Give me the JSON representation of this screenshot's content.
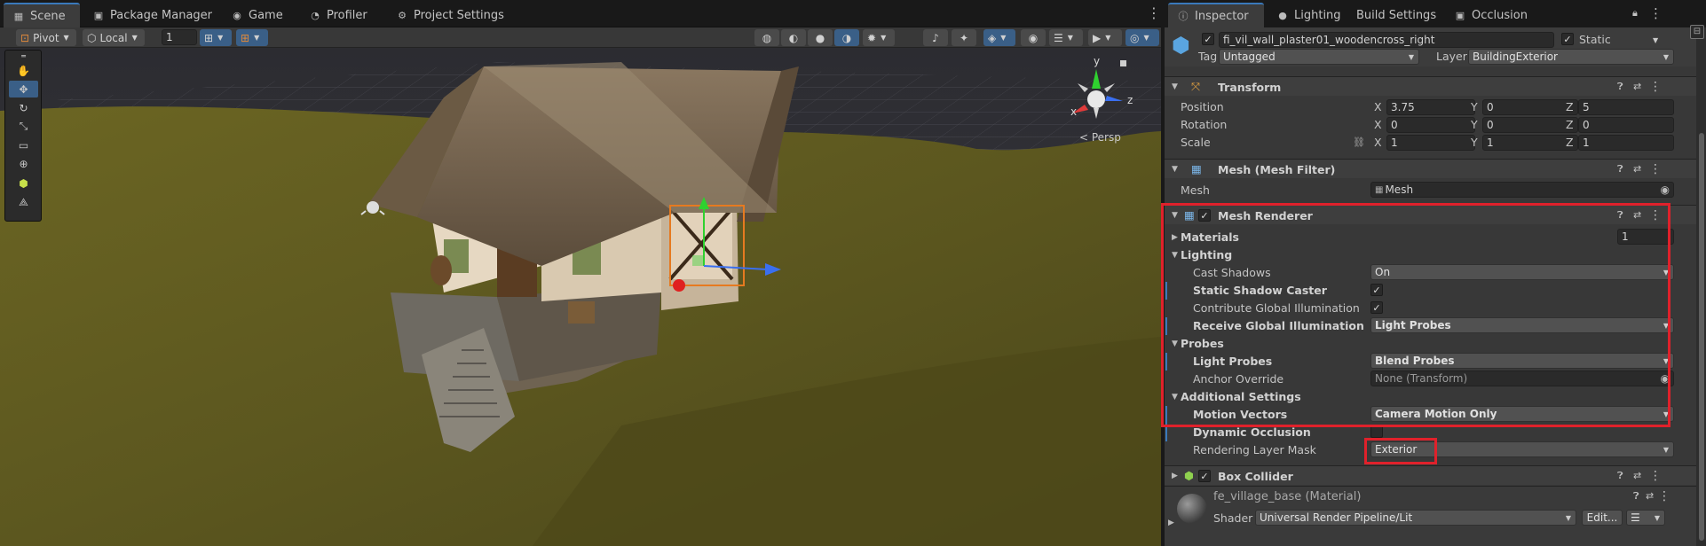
{
  "scene_tabs": [
    {
      "label": "Scene",
      "icon": "grid-icon"
    },
    {
      "label": "Package Manager",
      "icon": "package-icon"
    },
    {
      "label": "Game",
      "icon": "gamepad-icon"
    },
    {
      "label": "Profiler",
      "icon": "profiler-icon"
    },
    {
      "label": "Project Settings",
      "icon": "gear-icon"
    }
  ],
  "toolbar": {
    "pivot": "Pivot",
    "local": "Local",
    "grid_value": "1"
  },
  "scene_view": {
    "gizmo_y": "y",
    "gizmo_x": "x",
    "gizmo_z": "z",
    "projection": "< Persp"
  },
  "inspector_tabs": [
    {
      "label": "Inspector",
      "icon": "info-icon"
    },
    {
      "label": "Lighting",
      "icon": "bulb-icon"
    },
    {
      "label": "Build Settings",
      "icon": ""
    },
    {
      "label": "Occlusion",
      "icon": "occlusion-icon"
    }
  ],
  "object": {
    "name": "fi_vil_wall_plaster01_woodencross_right",
    "static_label": "Static",
    "tag_label": "Tag",
    "tag_value": "Untagged",
    "layer_label": "Layer",
    "layer_value": "BuildingExterior"
  },
  "transform": {
    "title": "Transform",
    "position_label": "Position",
    "position": {
      "x": "3.75",
      "y": "0",
      "z": "5"
    },
    "rotation_label": "Rotation",
    "rotation": {
      "x": "0",
      "y": "0",
      "z": "0"
    },
    "scale_label": "Scale",
    "scale": {
      "x": "1",
      "y": "1",
      "z": "1"
    },
    "axis_x": "X",
    "axis_y": "Y",
    "axis_z": "Z"
  },
  "mesh_filter": {
    "title": "Mesh (Mesh Filter)",
    "mesh_label": "Mesh",
    "mesh_value": "Mesh"
  },
  "mesh_renderer": {
    "title": "Mesh Renderer",
    "materials_label": "Materials",
    "materials_count": "1",
    "lighting_label": "Lighting",
    "cast_shadows_label": "Cast Shadows",
    "cast_shadows_value": "On",
    "static_shadow_caster_label": "Static Shadow Caster",
    "contribute_gi_label": "Contribute Global Illumination",
    "receive_gi_label": "Receive Global Illumination",
    "receive_gi_value": "Light Probes",
    "probes_label": "Probes",
    "light_probes_label": "Light Probes",
    "light_probes_value": "Blend Probes",
    "anchor_override_label": "Anchor Override",
    "anchor_override_value": "None (Transform)",
    "additional_label": "Additional Settings",
    "motion_vectors_label": "Motion Vectors",
    "motion_vectors_value": "Camera Motion Only",
    "dynamic_occlusion_label": "Dynamic Occlusion",
    "rendering_layer_label": "Rendering Layer Mask",
    "rendering_layer_value": "Exterior"
  },
  "box_collider": {
    "title": "Box Collider"
  },
  "material": {
    "name": "fe_village_base (Material)",
    "shader_label": "Shader",
    "shader_value": "Universal Render Pipeline/Lit",
    "edit_label": "Edit..."
  },
  "colors": {
    "accent": "#3a79bb",
    "highlight": "#e0212b",
    "ground": "#5f5a1f",
    "sky": "#2d2d33"
  }
}
